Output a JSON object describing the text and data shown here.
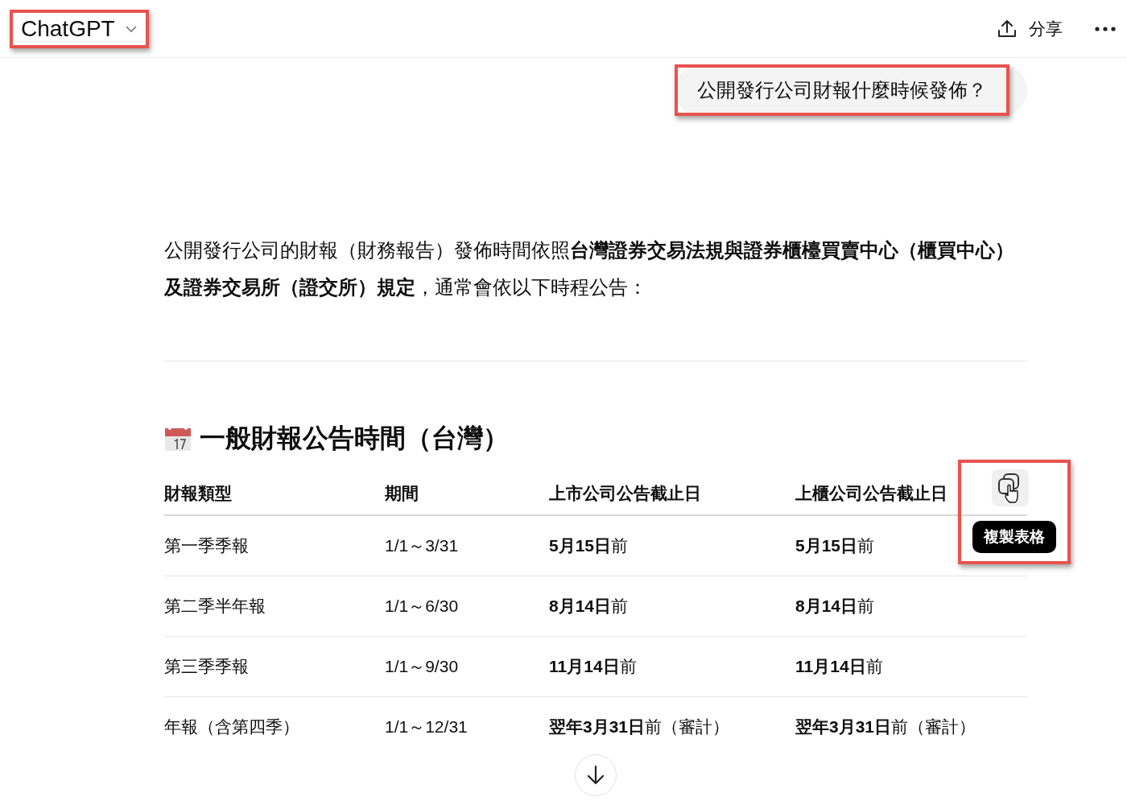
{
  "header": {
    "title": "ChatGPT",
    "title_highlighted": true,
    "share_label": "分享"
  },
  "user_message": {
    "text": "公開發行公司財報什麼時候發佈？",
    "highlighted": true
  },
  "answer": {
    "paragraph": "公開發行公司的財報（財務報告）發佈時間依照**台灣證券交易法規與證券櫃檯買賣中心（櫃買中心）及證券交易所（證交所）規定**，通常會依以下時程公告：",
    "heading": "一般財報公告時間（台灣）",
    "table": {
      "columns": [
        "財報類型",
        "期間",
        "上市公司公告截止日",
        "上櫃公司公告截止日"
      ],
      "rows": [
        [
          "第一季季報",
          "1/1～3/31",
          "**5月15日**前",
          "**5月15日**前"
        ],
        [
          "第二季半年報",
          "1/1～6/30",
          "**8月14日**前",
          "**8月14日**前"
        ],
        [
          "第三季季報",
          "1/1～9/30",
          "**11月14日**前",
          "**11月14日**前"
        ],
        [
          "年報（含第四季）",
          "1/1～12/31",
          "**翌年3月31日**前（審計）",
          "**翌年3月31日**前（審計）"
        ]
      ],
      "copy_button": {
        "tooltip": "複製表格",
        "highlighted": true
      }
    }
  }
}
